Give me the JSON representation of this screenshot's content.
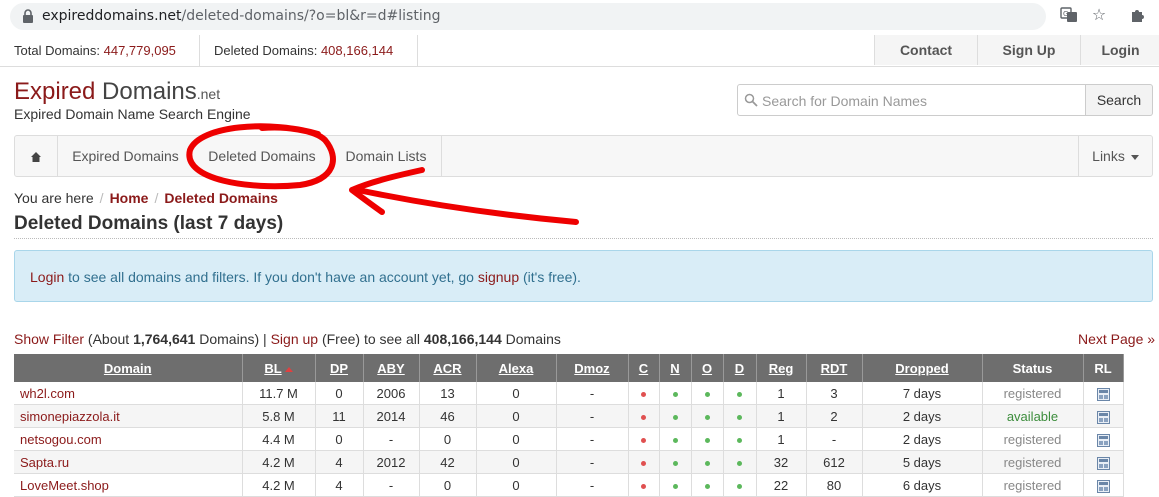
{
  "browser": {
    "url_host": "expireddomains.net",
    "url_path": "/deleted-domains/?o=bl&r=d#listing"
  },
  "stats": {
    "total_label": "Total Domains:",
    "total_value": "447,779,095",
    "deleted_label": "Deleted Domains:",
    "deleted_value": "408,166,144"
  },
  "top_nav": {
    "contact": "Contact",
    "signup": "Sign Up",
    "login": "Login"
  },
  "brand": {
    "word1": "Expired",
    "word2": "Domains",
    "tld": ".net",
    "tagline": "Expired Domain Name Search Engine"
  },
  "search": {
    "placeholder": "Search for Domain Names",
    "button": "Search"
  },
  "nav": {
    "expired": "Expired Domains",
    "deleted": "Deleted Domains",
    "lists": "Domain Lists",
    "links": "Links"
  },
  "breadcrumb": {
    "prefix": "You are here",
    "home": "Home",
    "current": "Deleted Domains"
  },
  "page_title": "Deleted Domains (last 7 days)",
  "alert": {
    "login": "Login",
    "middle": " to see all domains and filters. If you don't have an account yet, go ",
    "signup": "signup",
    "end": " (it's free)."
  },
  "filter": {
    "show_filter": "Show Filter",
    "about_pre": " (About ",
    "about_count": "1,764,641",
    "about_post": " Domains) | ",
    "signup": "Sign up",
    "free_pre": " (Free) to see all ",
    "all_count": "408,166,144",
    "free_post": " Domains",
    "next": "Next Page »"
  },
  "table": {
    "headers": [
      "Domain",
      "BL",
      "DP",
      "ABY",
      "ACR",
      "Alexa",
      "Dmoz",
      "C",
      "N",
      "O",
      "D",
      "Reg",
      "RDT",
      "Dropped",
      "Status",
      "RL"
    ],
    "rows": [
      {
        "domain": "wh2l.com",
        "bl": "11.7 M",
        "dp": "0",
        "aby": "2006",
        "acr": "13",
        "alexa": "0",
        "dmoz": "-",
        "c": "red",
        "n": "green",
        "o": "green",
        "d": "green",
        "reg": "1",
        "rdt": "3",
        "dropped": "7 days",
        "status": "registered"
      },
      {
        "domain": "simonepiazzola.it",
        "bl": "5.8 M",
        "dp": "11",
        "aby": "2014",
        "acr": "46",
        "alexa": "0",
        "dmoz": "-",
        "c": "red",
        "n": "green",
        "o": "green",
        "d": "green",
        "reg": "1",
        "rdt": "2",
        "dropped": "2 days",
        "status": "available"
      },
      {
        "domain": "netsogou.com",
        "bl": "4.4 M",
        "dp": "0",
        "aby": "-",
        "acr": "0",
        "alexa": "0",
        "dmoz": "-",
        "c": "red",
        "n": "green",
        "o": "green",
        "d": "green",
        "reg": "1",
        "rdt": "-",
        "dropped": "2 days",
        "status": "registered"
      },
      {
        "domain": "Sapta.ru",
        "bl": "4.2 M",
        "dp": "4",
        "aby": "2012",
        "acr": "42",
        "alexa": "0",
        "dmoz": "-",
        "c": "red",
        "n": "green",
        "o": "green",
        "d": "green",
        "reg": "32",
        "rdt": "612",
        "dropped": "5 days",
        "status": "registered"
      },
      {
        "domain": "LoveMeet.shop",
        "bl": "4.2 M",
        "dp": "4",
        "aby": "-",
        "acr": "0",
        "alexa": "0",
        "dmoz": "-",
        "c": "red",
        "n": "green",
        "o": "green",
        "d": "green",
        "reg": "22",
        "rdt": "80",
        "dropped": "6 days",
        "status": "registered"
      }
    ]
  },
  "colors": {
    "accent": "#8b1a1a",
    "dot_red": "#e05050",
    "dot_green": "#5cb85c",
    "annotation": "#ee0000"
  }
}
